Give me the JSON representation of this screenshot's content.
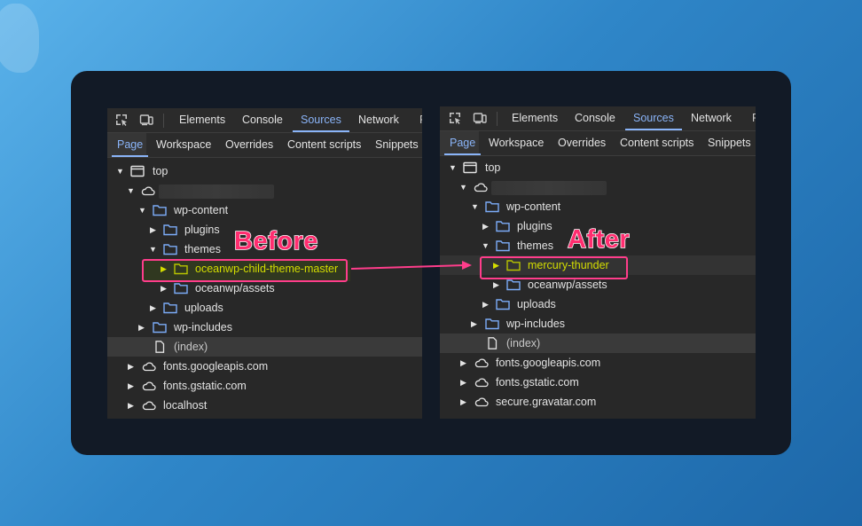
{
  "devtools_tabs": [
    "Elements",
    "Console",
    "Sources",
    "Network"
  ],
  "active_tab": "Sources",
  "sources_subtabs": [
    "Page",
    "Workspace",
    "Overrides",
    "Content scripts",
    "Snippets"
  ],
  "active_subtab": "Page",
  "annotations": {
    "before": "Before",
    "after": "After"
  },
  "highlight_color": "#ff3d8b",
  "before_tree": [
    {
      "label": "top",
      "icon": "frame-icon",
      "arrow": "down"
    },
    {
      "label": "",
      "icon": "cloud-icon",
      "arrow": "down",
      "blurred": true
    },
    {
      "label": "wp-content",
      "icon": "folder-icon",
      "arrow": "down"
    },
    {
      "label": "plugins",
      "icon": "folder-icon",
      "arrow": "right"
    },
    {
      "label": "themes",
      "icon": "folder-icon",
      "arrow": "down"
    },
    {
      "label": "oceanwp-child-theme-master",
      "icon": "folder-icon",
      "arrow": "right",
      "highlighted": true
    },
    {
      "label": "oceanwp/assets",
      "icon": "folder-icon",
      "arrow": "right"
    },
    {
      "label": "uploads",
      "icon": "folder-icon",
      "arrow": "right"
    },
    {
      "label": "wp-includes",
      "icon": "folder-icon",
      "arrow": "right"
    },
    {
      "label": "(index)",
      "icon": "file-icon",
      "arrow": "none",
      "selected": true
    },
    {
      "label": "fonts.googleapis.com",
      "icon": "cloud-icon",
      "arrow": "right"
    },
    {
      "label": "fonts.gstatic.com",
      "icon": "cloud-icon",
      "arrow": "right"
    },
    {
      "label": "localhost",
      "icon": "cloud-icon",
      "arrow": "right"
    }
  ],
  "after_tree": [
    {
      "label": "top",
      "icon": "frame-icon",
      "arrow": "down"
    },
    {
      "label": "",
      "icon": "cloud-icon",
      "arrow": "down",
      "blurred": true
    },
    {
      "label": "wp-content",
      "icon": "folder-icon",
      "arrow": "down"
    },
    {
      "label": "plugins",
      "icon": "folder-icon",
      "arrow": "right"
    },
    {
      "label": "themes",
      "icon": "folder-icon",
      "arrow": "down"
    },
    {
      "label": "mercury-thunder",
      "icon": "folder-icon",
      "arrow": "right",
      "highlighted": true
    },
    {
      "label": "oceanwp/assets",
      "icon": "folder-icon",
      "arrow": "right"
    },
    {
      "label": "uploads",
      "icon": "folder-icon",
      "arrow": "right"
    },
    {
      "label": "wp-includes",
      "icon": "folder-icon",
      "arrow": "right"
    },
    {
      "label": "(index)",
      "icon": "file-icon",
      "arrow": "none",
      "selected": true
    },
    {
      "label": "fonts.googleapis.com",
      "icon": "cloud-icon",
      "arrow": "right"
    },
    {
      "label": "fonts.gstatic.com",
      "icon": "cloud-icon",
      "arrow": "right"
    },
    {
      "label": "secure.gravatar.com",
      "icon": "cloud-icon",
      "arrow": "right"
    }
  ]
}
